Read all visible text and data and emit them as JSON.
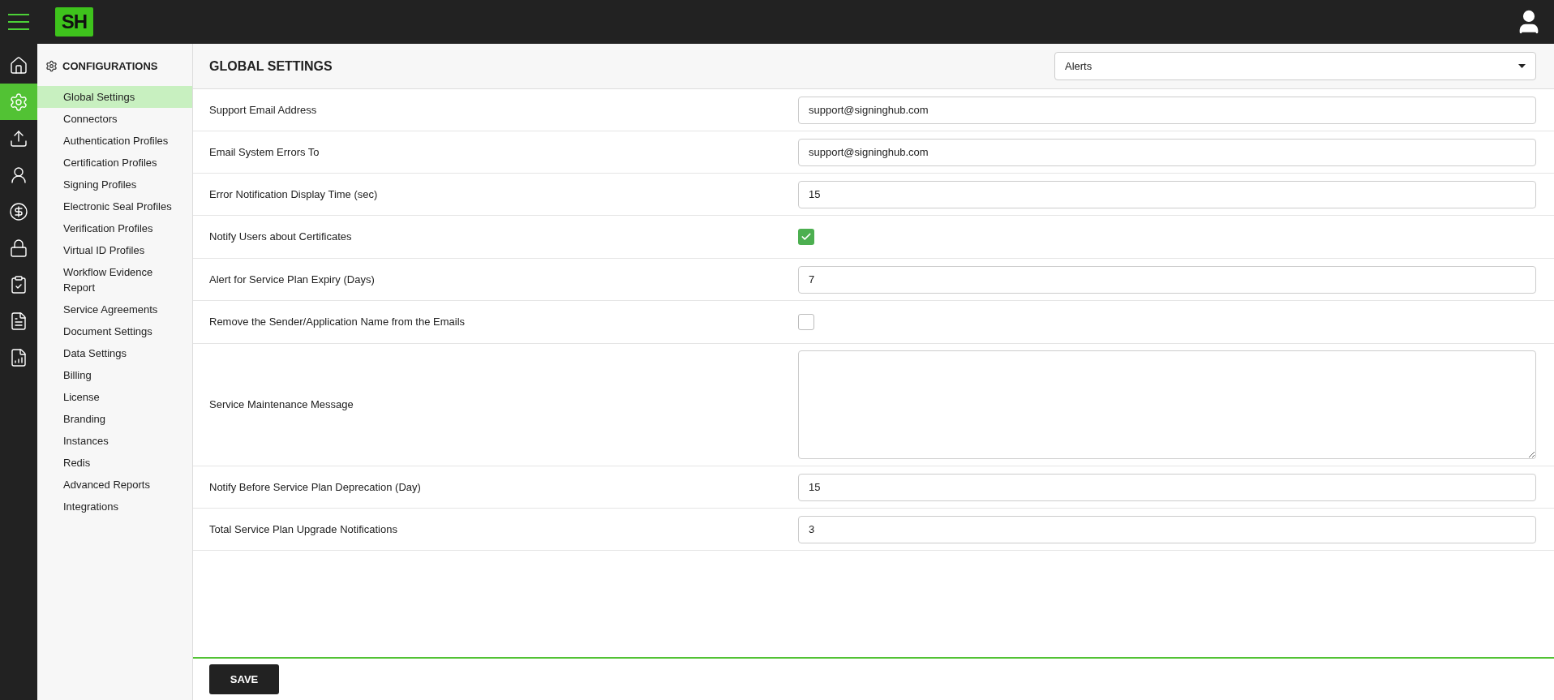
{
  "rail": [
    {
      "selected": false
    },
    {
      "selected": true
    },
    {
      "selected": false
    },
    {
      "selected": false
    },
    {
      "selected": false
    },
    {
      "selected": false
    },
    {
      "selected": false
    },
    {
      "selected": false
    },
    {
      "selected": false
    }
  ],
  "logo": "SH",
  "sidebar": {
    "title": "CONFIGURATIONS",
    "items": [
      {
        "label": "Global Settings",
        "selected": true
      },
      {
        "label": "Connectors",
        "selected": false
      },
      {
        "label": "Authentication Profiles",
        "selected": false
      },
      {
        "label": "Certification Profiles",
        "selected": false
      },
      {
        "label": "Signing Profiles",
        "selected": false
      },
      {
        "label": "Electronic Seal Profiles",
        "selected": false
      },
      {
        "label": "Verification Profiles",
        "selected": false
      },
      {
        "label": "Virtual ID Profiles",
        "selected": false
      },
      {
        "label": "Workflow Evidence Report",
        "selected": false
      },
      {
        "label": "Service Agreements",
        "selected": false
      },
      {
        "label": "Document Settings",
        "selected": false
      },
      {
        "label": "Data Settings",
        "selected": false
      },
      {
        "label": "Billing",
        "selected": false
      },
      {
        "label": "License",
        "selected": false
      },
      {
        "label": "Branding",
        "selected": false
      },
      {
        "label": "Instances",
        "selected": false
      },
      {
        "label": "Redis",
        "selected": false
      },
      {
        "label": "Advanced Reports",
        "selected": false
      },
      {
        "label": "Integrations",
        "selected": false
      }
    ]
  },
  "page": {
    "title": "GLOBAL SETTINGS",
    "section_select": "Alerts"
  },
  "fields": [
    {
      "kind": "text",
      "label": "Support Email Address",
      "value": "support@signinghub.com"
    },
    {
      "kind": "text",
      "label": "Email System Errors To",
      "value": "support@signinghub.com"
    },
    {
      "kind": "text",
      "label": "Error Notification Display Time (sec)",
      "value": "15"
    },
    {
      "kind": "checkbox",
      "label": "Notify Users about Certificates",
      "checked": true
    },
    {
      "kind": "text",
      "label": "Alert for Service Plan Expiry (Days)",
      "value": "7"
    },
    {
      "kind": "checkbox",
      "label": "Remove the Sender/Application Name from the Emails",
      "checked": false
    },
    {
      "kind": "textarea",
      "label": "Service Maintenance Message"
    },
    {
      "kind": "text",
      "label": "Notify Before Service Plan Deprecation (Day)",
      "value": "15"
    },
    {
      "kind": "text",
      "label": "Total Service Plan Upgrade Notifications",
      "value": "3"
    }
  ],
  "save_button": "SAVE"
}
